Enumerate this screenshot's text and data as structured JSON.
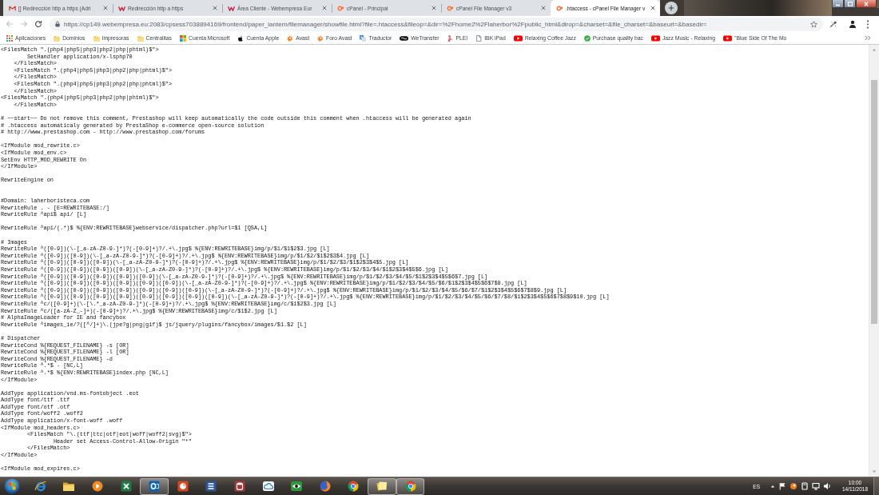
{
  "browser": {
    "tabs": [
      {
        "title": "[] Redirección http a https (Adri",
        "selected": false
      },
      {
        "title": "Redirección http a https",
        "selected": false
      },
      {
        "title": "Área Cliente - Webempresa Eur",
        "selected": false
      },
      {
        "title": "cPanel - Principal",
        "selected": false
      },
      {
        "title": "cPanel File Manager v3",
        "selected": false
      },
      {
        "title": ".htaccess - cPanel File Manager v",
        "selected": true
      }
    ],
    "toolbar": {
      "back": {
        "disabled": true
      },
      "forward": {
        "disabled": true
      },
      "url": "https://cp149.webempresa.eu:2083/cpsess7038894169/frontend/paper_lantern/filemanager/showfile.html?file=.htaccess&fileop=&dir=%2Fhome2%2Flaherbor%2Fpublic_html&dirop=&charset=&file_charset=&baseurl=&basedir="
    },
    "bookmarks": [
      {
        "kind": "apps",
        "label": "Aplicaciones"
      },
      {
        "kind": "folder",
        "label": "Dominios"
      },
      {
        "kind": "folder",
        "label": "Impresoras"
      },
      {
        "kind": "folder",
        "label": "Centralitas"
      },
      {
        "kind": "site",
        "label": "Cuenta Microsoft"
      },
      {
        "kind": "site",
        "label": "Cuenta Apple"
      },
      {
        "kind": "site",
        "label": "Avast"
      },
      {
        "kind": "site",
        "label": "Foro Avast"
      },
      {
        "kind": "site",
        "label": "Traductor"
      },
      {
        "kind": "site",
        "label": "WeTransfer"
      },
      {
        "kind": "site",
        "label": "PLEI"
      },
      {
        "kind": "site",
        "label": "IBK iPad"
      },
      {
        "kind": "site",
        "label": "Relaxing Coffee Jazz"
      },
      {
        "kind": "site",
        "label": "Purchase quality bac"
      },
      {
        "kind": "site",
        "label": "Jazz Music - Relaxing"
      },
      {
        "kind": "site",
        "label": "\"Blue Side Of The Mo"
      }
    ]
  },
  "file": {
    "lines": [
      {
        "kind": "text",
        "text": "<FilesMatch \".(php4|php5|php3|php2|php|phtml)$\">"
      },
      {
        "kind": "text",
        "text": "\tSetHandler application/x-lsphp70"
      },
      {
        "kind": "text",
        "text": "    </FilesMatch>"
      },
      {
        "kind": "text",
        "text": "    <FilesMatch \".(php4|php5|php3|php2|php|phtml)$\">"
      },
      {
        "kind": "text",
        "text": "    </FilesMatch>"
      },
      {
        "kind": "text",
        "text": "    <FilesMatch \".(php4|php5|php3|php2|php|phtml)$\">"
      },
      {
        "kind": "text",
        "text": "    </FilesMatch>"
      },
      {
        "kind": "text",
        "text": "<FilesMatch \".(php4|php5|php3|php2|php|phtml)$\">"
      },
      {
        "kind": "text",
        "text": "    </FilesMatch>"
      },
      {
        "kind": "blank"
      },
      {
        "kind": "text",
        "text": "# ~~start~~ Do not remove this comment, Prestashop will keep automatically the code outside this comment when .htaccess will be generated again"
      },
      {
        "kind": "text",
        "text": "# .htaccess automaticaly generated by PrestaShop e-commerce open-source solution"
      },
      {
        "kind": "text",
        "text": "# http://www.prestashop.com - http://www.prestashop.com/forums"
      },
      {
        "kind": "blank"
      },
      {
        "kind": "text",
        "text": "<IfModule mod_rewrite.c>"
      },
      {
        "kind": "text",
        "text": "<IfModule mod_env.c>"
      },
      {
        "kind": "text",
        "text": "SetEnv HTTP_MOD_REWRITE On"
      },
      {
        "kind": "text",
        "text": "</IfModule>"
      },
      {
        "kind": "blank"
      },
      {
        "kind": "text",
        "text": "RewriteEngine on"
      },
      {
        "kind": "blank"
      },
      {
        "kind": "blank"
      },
      {
        "kind": "text",
        "text": "#Domain: laherboristeca.com"
      },
      {
        "kind": "text",
        "text": "RewriteRule . - [E=REWRITEBASE:/]"
      },
      {
        "kind": "text",
        "text": "RewriteRule ^api$ api/ [L]"
      },
      {
        "kind": "blank"
      },
      {
        "kind": "text",
        "text": "RewriteRule ^api/(.*)$ %{ENV:REWRITEBASE}webservice/dispatcher.php?url=$1 [QSA,L]"
      },
      {
        "kind": "blank"
      },
      {
        "kind": "text",
        "text": "# Images"
      },
      {
        "kind": "text",
        "text": "RewriteRule ^([0-9])(\\-[_a-zA-Z0-9-]*)?(-[0-9]+)?/.+\\.jpg$ %{ENV:REWRITEBASE}img/p/$1/$1$2$3.jpg [L]"
      },
      {
        "kind": "text",
        "text": "RewriteRule ^([0-9])([0-9])(\\-[_a-zA-Z0-9-]*)?(-[0-9]+)?/.+\\.jpg$ %{ENV:REWRITEBASE}img/p/$1/$2/$1$2$3$4.jpg [L]"
      },
      {
        "kind": "text",
        "text": "RewriteRule ^([0-9])([0-9])([0-9])(\\-[_a-zA-Z0-9-]*)?(-[0-9]+)?/.+\\.jpg$ %{ENV:REWRITEBASE}img/p/$1/$2/$3/$1$2$3$4$5.jpg [L]"
      },
      {
        "kind": "text",
        "text": "RewriteRule ^([0-9])([0-9])([0-9])([0-9])(\\-[_a-zA-Z0-9-]*)?(-[0-9]+)?/.+\\.jpg$ %{ENV:REWRITEBASE}img/p/$1/$2/$3/$4/$1$2$3$4$5$6.jpg [L]"
      },
      {
        "kind": "text",
        "text": "RewriteRule ^([0-9])([0-9])([0-9])([0-9])([0-9])(\\-[_a-zA-Z0-9-]*)?(-[0-9]+)?/.+\\.jpg$ %{ENV:REWRITEBASE}img/p/$1/$2/$3/$4/$5/$1$2$3$4$5$6$7.jpg [L]"
      },
      {
        "kind": "text",
        "text": "RewriteRule ^([0-9])([0-9])([0-9])([0-9])([0-9])([0-9])(\\-[_a-zA-Z0-9-]*)?(-[0-9]+)?/.+\\.jpg$ %{ENV:REWRITEBASE}img/p/$1/$2/$3/$4/$5/$6/$1$2$3$4$5$6$7$8.jpg [L]"
      },
      {
        "kind": "text",
        "text": "RewriteRule ^([0-9])([0-9])([0-9])([0-9])([0-9])([0-9])([0-9])(\\-[_a-zA-Z0-9-]*)?(-[0-9]+)?/.+\\.jpg$ %{ENV:REWRITEBASE}img/p/$1/$2/$3/$4/$5/$6/$7/$1$2$3$4$5$6$7$8$9.jpg [L]"
      },
      {
        "kind": "text",
        "text": "RewriteRule ^([0-9])([0-9])([0-9])([0-9])([0-9])([0-9])([0-9])([0-9])(\\-[_a-zA-Z0-9-]*)?(-[0-9]+)?/.+\\.jpg$ %{ENV:REWRITEBASE}img/p/$1/$2/$3/$4/$5/$6/$7/$8/$1$2$3$4$5$6$7$8$9$10.jpg [L]"
      },
      {
        "kind": "text",
        "text": "RewriteRule ^c/([0-9]+)(\\-[\\.*_a-zA-Z0-9-]*)(-[0-9]+)?/.+\\.jpg$ %{ENV:REWRITEBASE}img/c/$1$2$3.jpg [L]"
      },
      {
        "kind": "text",
        "text": "RewriteRule ^c/([a-zA-Z_-]+)(-[0-9]+)?/.+\\.jpg$ %{ENV:REWRITEBASE}img/c/$1$2.jpg [L]"
      },
      {
        "kind": "text",
        "text": "# AlphaImageLoader for IE and fancybox"
      },
      {
        "kind": "text",
        "text": "RewriteRule ^images_ie/?([^/]+)\\.(jpe?g|png|gif)$ js/jquery/plugins/fancybox/images/$1.$2 [L]"
      },
      {
        "kind": "blank"
      },
      {
        "kind": "text",
        "text": "# Dispatcher"
      },
      {
        "kind": "text",
        "text": "RewriteCond %{REQUEST_FILENAME} -s [OR]"
      },
      {
        "kind": "text",
        "text": "RewriteCond %{REQUEST_FILENAME} -l [OR]"
      },
      {
        "kind": "text",
        "text": "RewriteCond %{REQUEST_FILENAME} -d"
      },
      {
        "kind": "text",
        "text": "RewriteRule ^.*$ - [NC,L]"
      },
      {
        "kind": "text",
        "text": "RewriteRule ^.*$ %{ENV:REWRITEBASE}index.php [NC,L]"
      },
      {
        "kind": "text",
        "text": "</IfModule>"
      },
      {
        "kind": "blank"
      },
      {
        "kind": "text",
        "text": "AddType application/vnd.ms-fontobject .eot"
      },
      {
        "kind": "text",
        "text": "AddType font/ttf .ttf"
      },
      {
        "kind": "text",
        "text": "AddType font/otf .otf"
      },
      {
        "kind": "text",
        "text": "AddType font/woff2 .woff2"
      },
      {
        "kind": "text",
        "text": "AddType application/x-font-woff .woff"
      },
      {
        "kind": "text",
        "text": "<IfModule mod_headers.c>"
      },
      {
        "kind": "text",
        "text": "\t<FilesMatch \"\\.(ttf|ttc|otf|eot|woff|woff2|svg)$\">"
      },
      {
        "kind": "text",
        "text": "\t\tHeader set Access-Control-Allow-Origin \"*\""
      },
      {
        "kind": "text",
        "text": "\t</FilesMatch>"
      },
      {
        "kind": "text",
        "text": "</IfModule>"
      },
      {
        "kind": "blank"
      },
      {
        "kind": "text",
        "text": "<IfModule mod_expires.c>"
      }
    ]
  },
  "taskbar": {
    "apps": [
      {
        "running": false
      },
      {
        "running": false
      },
      {
        "running": false
      },
      {
        "running": false
      },
      {
        "running": true
      },
      {
        "running": false
      },
      {
        "running": false
      },
      {
        "running": false
      },
      {
        "running": false
      },
      {
        "running": false
      },
      {
        "running": false
      },
      {
        "running": false
      },
      {
        "running": true
      },
      {
        "running": true
      }
    ],
    "tray": {
      "language": "ES",
      "time": "10:00",
      "date": "14/11/2018"
    }
  }
}
